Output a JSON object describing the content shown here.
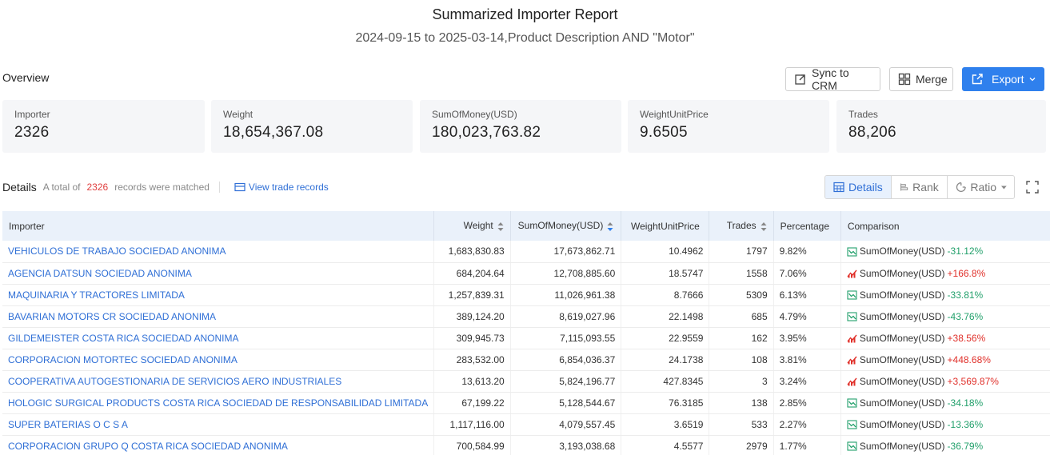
{
  "report": {
    "title": "Summarized Importer Report",
    "subtitle": "2024-09-15 to 2025-03-14,Product Description AND \"Motor\""
  },
  "overview": {
    "label": "Overview",
    "sync_label": "Sync to CRM",
    "merge_label": "Merge",
    "export_label": "Export",
    "cards": [
      {
        "label": "Importer",
        "value": "2326"
      },
      {
        "label": "Weight",
        "value": "18,654,367.08"
      },
      {
        "label": "SumOfMoney(USD)",
        "value": "180,023,763.82"
      },
      {
        "label": "WeightUnitPrice",
        "value": "9.6505"
      },
      {
        "label": "Trades",
        "value": "88,206"
      }
    ]
  },
  "details": {
    "label": "Details",
    "total_prefix": "A total of",
    "total_count": "2326",
    "total_suffix": "records were matched",
    "view_records": "View trade records",
    "view_tabs": [
      "Details",
      "Rank",
      "Ratio"
    ]
  },
  "table": {
    "headers": [
      "Importer",
      "Weight",
      "SumOfMoney(USD)",
      "WeightUnitPrice",
      "Trades",
      "Percentage",
      "Comparison"
    ],
    "rows": [
      {
        "importer": "VEHICULOS DE TRABAJO SOCIEDAD ANONIMA",
        "weight": "1,683,830.83",
        "money": "17,673,862.71",
        "unit_price": "10.4962",
        "trades": "1797",
        "percentage": "9.82%",
        "cmp_label": "SumOfMoney(USD)",
        "cmp_value": "-31.12%",
        "trend": "down"
      },
      {
        "importer": "AGENCIA DATSUN SOCIEDAD ANONIMA",
        "weight": "684,204.64",
        "money": "12,708,885.60",
        "unit_price": "18.5747",
        "trades": "1558",
        "percentage": "7.06%",
        "cmp_label": "SumOfMoney(USD)",
        "cmp_value": "+166.8%",
        "trend": "up"
      },
      {
        "importer": "MAQUINARIA Y TRACTORES LIMITADA",
        "weight": "1,257,839.31",
        "money": "11,026,961.38",
        "unit_price": "8.7666",
        "trades": "5309",
        "percentage": "6.13%",
        "cmp_label": "SumOfMoney(USD)",
        "cmp_value": "-33.81%",
        "trend": "down"
      },
      {
        "importer": "BAVARIAN MOTORS CR SOCIEDAD ANONIMA",
        "weight": "389,124.20",
        "money": "8,619,027.96",
        "unit_price": "22.1498",
        "trades": "685",
        "percentage": "4.79%",
        "cmp_label": "SumOfMoney(USD)",
        "cmp_value": "-43.76%",
        "trend": "down"
      },
      {
        "importer": "GILDEMEISTER COSTA RICA SOCIEDAD ANONIMA",
        "weight": "309,945.73",
        "money": "7,115,093.55",
        "unit_price": "22.9559",
        "trades": "162",
        "percentage": "3.95%",
        "cmp_label": "SumOfMoney(USD)",
        "cmp_value": "+38.56%",
        "trend": "up"
      },
      {
        "importer": "CORPORACION MOTORTEC SOCIEDAD ANONIMA",
        "weight": "283,532.00",
        "money": "6,854,036.37",
        "unit_price": "24.1738",
        "trades": "108",
        "percentage": "3.81%",
        "cmp_label": "SumOfMoney(USD)",
        "cmp_value": "+448.68%",
        "trend": "up"
      },
      {
        "importer": "COOPERATIVA AUTOGESTIONARIA DE SERVICIOS AERO INDUSTRIALES",
        "weight": "13,613.20",
        "money": "5,824,196.77",
        "unit_price": "427.8345",
        "trades": "3",
        "percentage": "3.24%",
        "cmp_label": "SumOfMoney(USD)",
        "cmp_value": "+3,569.87%",
        "trend": "up"
      },
      {
        "importer": "HOLOGIC SURGICAL PRODUCTS COSTA RICA SOCIEDAD DE RESPONSABILIDAD LIMITADA",
        "weight": "67,199.22",
        "money": "5,128,544.67",
        "unit_price": "76.3185",
        "trades": "138",
        "percentage": "2.85%",
        "cmp_label": "SumOfMoney(USD)",
        "cmp_value": "-34.18%",
        "trend": "down"
      },
      {
        "importer": "SUPER BATERIAS O C S A",
        "weight": "1,117,116.00",
        "money": "4,079,557.45",
        "unit_price": "3.6519",
        "trades": "533",
        "percentage": "2.27%",
        "cmp_label": "SumOfMoney(USD)",
        "cmp_value": "-13.36%",
        "trend": "down"
      },
      {
        "importer": "CORPORACION GRUPO Q COSTA RICA SOCIEDAD ANONIMA",
        "weight": "700,584.99",
        "money": "3,193,038.68",
        "unit_price": "4.5577",
        "trades": "2979",
        "percentage": "1.77%",
        "cmp_label": "SumOfMoney(USD)",
        "cmp_value": "-36.79%",
        "trend": "down"
      }
    ]
  },
  "colors": {
    "accent": "#2f80ed",
    "up": "#e0302a",
    "down": "#22a06b",
    "header_bg": "#eaf1fa"
  }
}
